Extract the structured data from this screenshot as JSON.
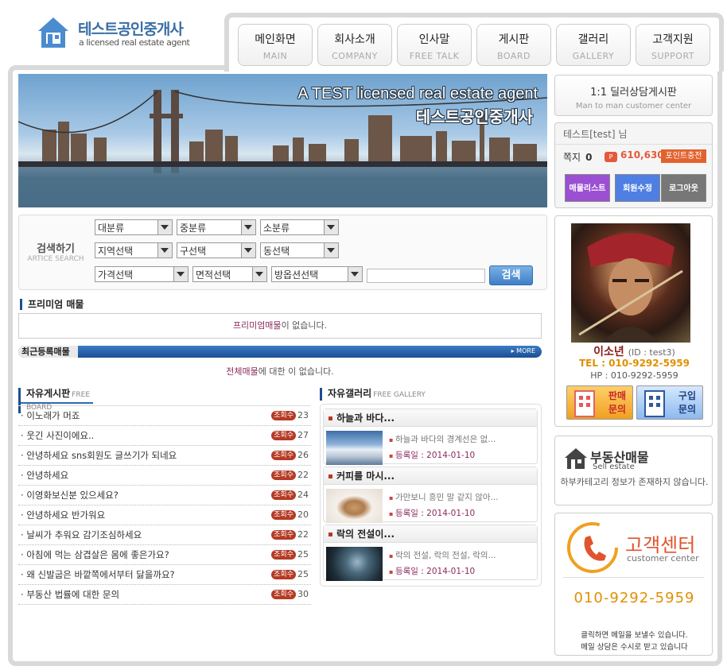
{
  "logo": {
    "title": "테스트공인중개사",
    "subtitle": "a licensed real estate agent"
  },
  "nav": [
    {
      "label": "메인화면",
      "sub": "MAIN"
    },
    {
      "label": "회사소개",
      "sub": "COMPANY"
    },
    {
      "label": "인사말",
      "sub": "FREE TALK"
    },
    {
      "label": "게시판",
      "sub": "BOARD"
    },
    {
      "label": "갤러리",
      "sub": "GALLERY"
    },
    {
      "label": "고객지원",
      "sub": "SUPPORT"
    }
  ],
  "banner": {
    "en": "A TEST  licensed real estate agent",
    "ko": "테스트공인중개사"
  },
  "search": {
    "label": "검색하기",
    "label_en": "ARTICE SEARCH",
    "selects": [
      "대분류",
      "중분류",
      "소분류",
      "지역선택",
      "구선택",
      "동선택",
      "가격선택",
      "면적선택",
      "방옵션선택"
    ],
    "button": "검색"
  },
  "premium": {
    "title": "프리미엄 매물",
    "empty_hl": "프리미엄매물",
    "empty_rest": "이 없습니다."
  },
  "recent": {
    "title": "최근등록매물",
    "more": "▸ MORE",
    "empty_hl": "전체매물",
    "empty_rest": "에 대한 이 없습니다."
  },
  "board": {
    "title": "자유게시판",
    "title_en": "FREE BOARD",
    "badge": "조회수",
    "items": [
      {
        "title": "이노래가 머죠",
        "views": "23"
      },
      {
        "title": "웃긴 사진이에요..",
        "views": "27"
      },
      {
        "title": "안녕하세요 sns회원도 글쓰기가 되네요",
        "views": "26"
      },
      {
        "title": "안녕하세요",
        "views": "22"
      },
      {
        "title": "이영화보신분 있으세요?",
        "views": "24"
      },
      {
        "title": "안녕하세요 반가워요",
        "views": "20"
      },
      {
        "title": "날씨가 추워요 감기조심하세요",
        "views": "22"
      },
      {
        "title": "아침에 먹는 삼겹살은 몸에 좋은가요?",
        "views": "25"
      },
      {
        "title": "왜 신발굽은 바깥쪽에서부터 닳을까요?",
        "views": "25"
      },
      {
        "title": "부동산 법률에 대한 문의",
        "views": "30"
      }
    ]
  },
  "gallery": {
    "title": "자유갤러리",
    "title_en": "FREE GALLERY",
    "items": [
      {
        "title": "하늘과 바다...",
        "desc": "하늘과 바다의 경계선은 없...",
        "date": "등록일 : 2014-01-10"
      },
      {
        "title": "커피를 마시...",
        "desc": "가만보니 흥민 말 같지 않아...",
        "date": "등록일 : 2014-01-10"
      },
      {
        "title": "락의 전설이...",
        "desc": "락의 전설, 락의 전설, 락의...",
        "date": "등록일 : 2014-01-10"
      }
    ]
  },
  "counsel": {
    "title": "1:1 딜러상담게시판",
    "sub": "Man to man customer center"
  },
  "user": {
    "name": "테스트[test]",
    "suffix": " 님",
    "memo_label": "쪽지",
    "memo_count": "0",
    "point_icon": "P",
    "points": "610,630",
    "charge_btn": "포인트충전",
    "buttons": [
      {
        "label": "매물리스트",
        "color": "#9b4fd3"
      },
      {
        "label": "회원수정",
        "color": "#4f7fe3"
      },
      {
        "label": "로그아웃",
        "color": "#777777"
      }
    ]
  },
  "agent": {
    "name": "이소년",
    "id": "(ID : test3)",
    "tel": "TEL : 010-9292-5959",
    "hp": "HP : 010-9292-5959",
    "sell_btn": [
      "판매",
      "문의"
    ],
    "buy_btn": [
      "구입",
      "문의"
    ]
  },
  "realestate": {
    "title": "부동산매물",
    "sub": "Sell estate",
    "msg": "하부카테고리 정보가 존재하지 않습니다."
  },
  "customer_center": {
    "title": "고객센터",
    "sub": "customer center",
    "number": "010-9292-5959",
    "note1": "클릭하면 메일을 보낼수 있습니다.",
    "note2": "메일 상담은 수시로 받고 있습니다"
  },
  "colors": {
    "brand": "#3a6ea5",
    "accent": "#1d4f90",
    "badge": "#b53a24",
    "point": "#e25a3a"
  }
}
